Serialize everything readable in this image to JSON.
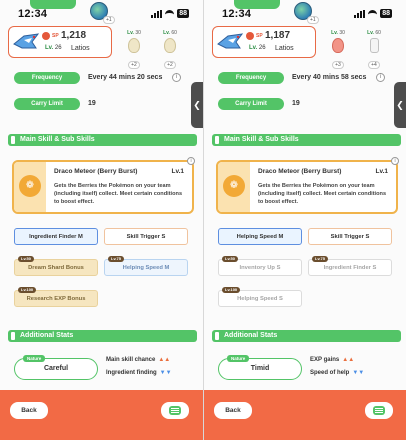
{
  "panels": [
    {
      "status": {
        "time": "12:34",
        "battery": "88"
      },
      "globe_badge": "+1",
      "pokemon": {
        "sp_label": "SP",
        "sp_value": "1,218",
        "level_label": "Lv.",
        "level": "26",
        "name": "Latios"
      },
      "unlocks": [
        {
          "level": "30",
          "count": "+2",
          "item": "egg"
        },
        {
          "level": "60",
          "count": "+2",
          "item": "egg"
        }
      ],
      "frequency": {
        "label": "Frequency",
        "value": "Every 44 mins 20 secs"
      },
      "carry": {
        "label": "Carry Limit",
        "value": "19"
      },
      "section_skills": "Main Skill & Sub Skills",
      "main_skill": {
        "name": "Draco Meteor (Berry Burst)",
        "level": "Lv.1",
        "description": "Gets the Berries the Pokémon on your team (including itself) collect. Meet certain conditions to boost effect."
      },
      "sub_skills": [
        {
          "label": "Ingredient Finder M",
          "tag": "",
          "style": "active"
        },
        {
          "label": "Skill Trigger S",
          "tag": "",
          "style": "plain"
        },
        {
          "label": "Dream Shard Bonus",
          "tag": "Lv.50",
          "style": "locked-gold"
        },
        {
          "label": "Helping Speed M",
          "tag": "Lv.75",
          "style": "locked-blue"
        },
        {
          "label": "Research EXP Bonus",
          "tag": "Lv.100",
          "style": "locked-gold"
        }
      ],
      "section_stats": "Additional Stats",
      "nature": {
        "tag": "Nature",
        "value": "Careful"
      },
      "stats": [
        {
          "label": "Main skill chance",
          "dir": "up",
          "arrows": "▲▲"
        },
        {
          "label": "Ingredient finding",
          "dir": "down",
          "arrows": "▼▼"
        }
      ],
      "back_label": "Back"
    },
    {
      "status": {
        "time": "12:34",
        "battery": "88"
      },
      "globe_badge": "+1",
      "pokemon": {
        "sp_label": "SP",
        "sp_value": "1,187",
        "level_label": "Lv.",
        "level": "26",
        "name": "Latios"
      },
      "unlocks": [
        {
          "level": "30",
          "count": "+3",
          "item": "berry"
        },
        {
          "level": "60",
          "count": "+4",
          "item": "milk"
        }
      ],
      "frequency": {
        "label": "Frequency",
        "value": "Every 40 mins 58 secs"
      },
      "carry": {
        "label": "Carry Limit",
        "value": "19"
      },
      "section_skills": "Main Skill & Sub Skills",
      "main_skill": {
        "name": "Draco Meteor (Berry Burst)",
        "level": "Lv.1",
        "description": "Gets the Berries the Pokémon on your team (including itself) collect. Meet certain conditions to boost effect."
      },
      "sub_skills": [
        {
          "label": "Helping Speed M",
          "tag": "",
          "style": "active"
        },
        {
          "label": "Skill Trigger S",
          "tag": "",
          "style": "plain"
        },
        {
          "label": "Inventory Up S",
          "tag": "Lv.50",
          "style": "locked-grey"
        },
        {
          "label": "Ingredient Finder S",
          "tag": "Lv.75",
          "style": "locked-grey"
        },
        {
          "label": "Helping Speed S",
          "tag": "Lv.100",
          "style": "locked-grey"
        }
      ],
      "section_stats": "Additional Stats",
      "nature": {
        "tag": "Nature",
        "value": "Timid"
      },
      "stats": [
        {
          "label": "EXP gains",
          "dir": "up",
          "arrows": "▲▲"
        },
        {
          "label": "Speed of help",
          "dir": "down",
          "arrows": "▼▼"
        }
      ],
      "back_label": "Back"
    }
  ],
  "colors": {
    "accent_green": "#53c467",
    "accent_orange": "#f26a45",
    "skill_gold": "#f0b34b"
  }
}
